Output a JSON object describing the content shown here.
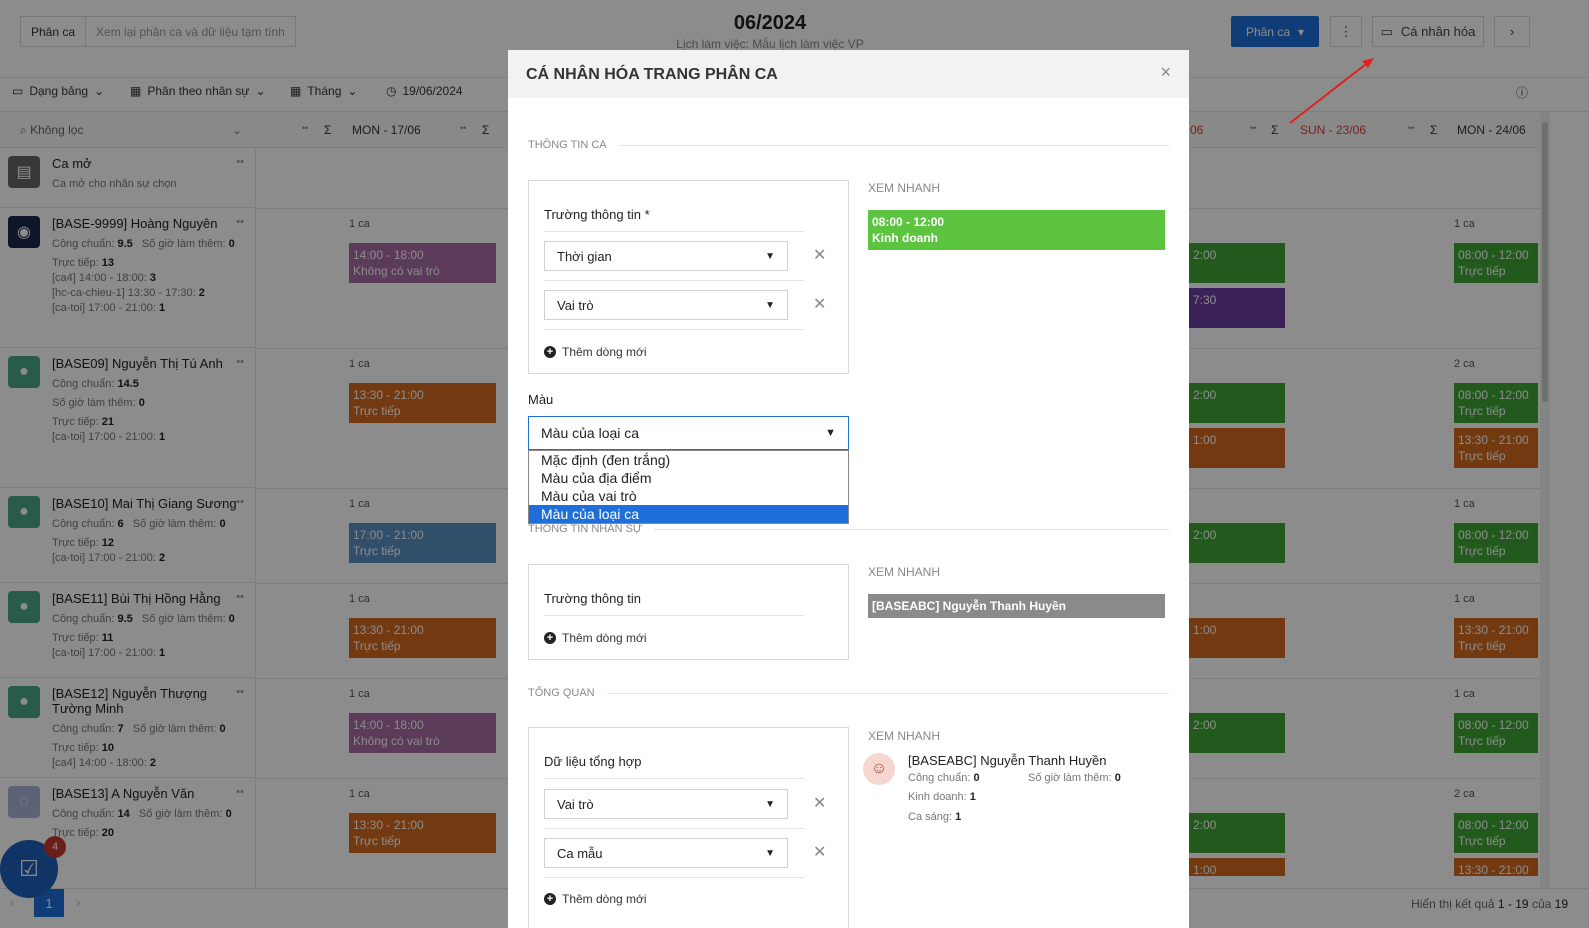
{
  "page": {
    "seg_primary": "Phân ca",
    "seg_secondary": "Xem lại phân ca và dữ liệu tạm tính",
    "title": "06/2024",
    "subtitle": "Lịch làm việc: Mẫu lịch làm việc VP",
    "btn_phanca": "Phân ca",
    "btn_canhan": "Cá nhân hóa",
    "more_icon": "⋮",
    "next_icon": "›"
  },
  "toolbar": {
    "view": "Dạng bảng",
    "group": "Phân theo nhân sự",
    "period": "Tháng",
    "date": "19/06/2024",
    "filter": "Không lọc"
  },
  "grid": {
    "col_mon17": "MON - 17/06",
    "col_06": "06",
    "col_sun23": "SUN - 23/06",
    "col_mon24": "MON - 24/06",
    "sigma": "Σ",
    "dots": "••"
  },
  "employees": [
    {
      "name": "Ca mở",
      "l1": "Ca mở cho nhân sự chọn"
    },
    {
      "name": "[BASE-9999] Hoàng Nguyên",
      "l1k": "Công chuẩn:",
      "l1v": "9.5",
      "l1k2": "Số giờ làm thêm:",
      "l1v2": "0",
      "l2k": "Trực tiếp:",
      "l2v": "13",
      "l3k": "[ca4] 14:00 - 18:00:",
      "l3v": "3",
      "l4k": "[hc-ca-chieu-1] 13:30 - 17:30:",
      "l4v": "2",
      "l5k": "[ca-toi] 17:00 - 21:00:",
      "l5v": "1"
    },
    {
      "name": "[BASE09] Nguyễn Thị Tú Anh",
      "l1k": "Công chuẩn:",
      "l1v": "14.5",
      "l2k": "Số giờ làm thêm:",
      "l2v": "0",
      "l3k": "Trực tiếp:",
      "l3v": "21",
      "l4k": "[ca-toi] 17:00 - 21:00:",
      "l4v": "1"
    },
    {
      "name": "[BASE10] Mai Thị Giang Sương",
      "l1k": "Công chuẩn:",
      "l1v": "6",
      "l1k2": "Số giờ làm thêm:",
      "l1v2": "0",
      "l2k": "Trực tiếp:",
      "l2v": "12",
      "l3k": "[ca-toi] 17:00 - 21:00:",
      "l3v": "2"
    },
    {
      "name": "[BASE11] Bùi Thị Hồng Hằng",
      "l1k": "Công chuẩn:",
      "l1v": "9.5",
      "l1k2": "Số giờ làm thêm:",
      "l1v2": "0",
      "l2k": "Trực tiếp:",
      "l2v": "11",
      "l3k": "[ca-toi] 17:00 - 21:00:",
      "l3v": "1"
    },
    {
      "name": "[BASE12] Nguyễn Thượng Tường Minh",
      "l1k": "Công chuẩn:",
      "l1v": "7",
      "l1k2": "Số giờ làm thêm:",
      "l1v2": "0",
      "l2k": "Trực tiếp:",
      "l2v": "10",
      "l3k": "[ca4] 14:00 - 18:00:",
      "l3v": "2"
    },
    {
      "name": "[BASE13] A Nguyễn Văn",
      "l1k": "Công chuẩn:",
      "l1v": "14",
      "l1k2": "Số giờ làm thêm:",
      "l1v2": "0",
      "l2k": "Trực tiếp:",
      "l2v": "20"
    }
  ],
  "counts": {
    "one": "1 ca",
    "two": "2 ca"
  },
  "shifts": {
    "t1418": "14:00 - 18:00",
    "t1330": "13:30 - 21:00",
    "t1700": "17:00 - 21:00",
    "t0812": "08:00 - 12:00",
    "r_none": "Không có vai trò",
    "r_tt": "Trực tiếp",
    "p1": "2:00",
    "p2": "7:30",
    "p3": "1:00",
    "p4": "1:00"
  },
  "pager": {
    "page": "1",
    "info_prefix": "Hiển thị kết quả",
    "range": "1 - 19",
    "of": "của",
    "total": "19",
    "badge": "4"
  },
  "modal": {
    "title": "CÁ NHÂN HÓA TRANG PHÂN CA",
    "close": "×",
    "sec_shift": "THÔNG TIN CA",
    "sec_staff": "THÔNG TIN NHÂN SỰ",
    "sec_overview": "TỔNG QUAN",
    "field_req": "Trường thông tin *",
    "field": "Trường thông tin",
    "summary": "Dữ liệu tổng hợp",
    "sel_time": "Thời gian",
    "sel_role": "Vai trò",
    "sel_role2": "Vai trò",
    "sel_sample": "Ca mẫu",
    "add_row": "Thêm dòng mới",
    "quick_view": "XEM NHANH",
    "color_label": "Màu",
    "color_value": "Màu của loại ca",
    "color_options": [
      "Mặc định (đen trắng)",
      "Màu của địa điểm",
      "Màu của vai trò",
      "Màu của loại ca"
    ],
    "qv_time": "08:00 - 12:00",
    "qv_dept": "Kinh doanh",
    "qv_staff": "[BASEABC] Nguyễn Thanh Huyền",
    "card_name": "[BASEABC] Nguyễn Thanh Huyền",
    "card_k1": "Công chuẩn:",
    "card_v1": "0",
    "card_k2": "Số giờ làm thêm:",
    "card_v2": "0",
    "card_k3": "Kinh doanh:",
    "card_v3": "1",
    "card_k4": "Ca sáng:",
    "card_v4": "1"
  },
  "colors": {
    "primary": "#1e6fd9",
    "green": "#5dc43f",
    "orange": "#d26a1f",
    "purple": "#a86aa3",
    "arrow": "#e02020"
  }
}
